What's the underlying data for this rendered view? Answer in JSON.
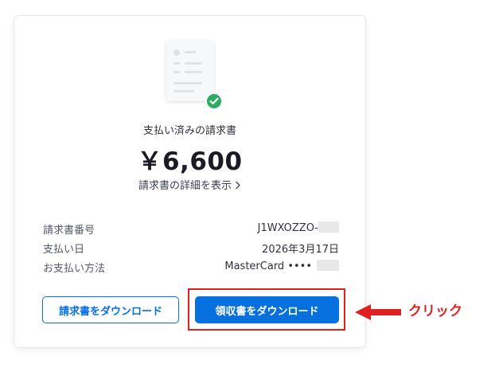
{
  "receipt": {
    "status_title": "支払い済みの請求書",
    "amount": "￥6,600",
    "details_link": "請求書の詳細を表示",
    "rows": [
      {
        "label": "請求書番号",
        "value": "J1WXOZZO-"
      },
      {
        "label": "支払い日",
        "value": "2026年3月17日"
      },
      {
        "label": "お支払い方法",
        "value": "MasterCard ••••"
      }
    ],
    "download_invoice_label": "請求書をダウンロード",
    "download_receipt_label": "領収書をダウンロード"
  },
  "annotation": {
    "click_label": "クリック",
    "color": "#e02020"
  },
  "colors": {
    "primary": "#0570de",
    "success": "#2cab65"
  },
  "icons": {
    "document": "invoice-document-icon",
    "check": "check-circle-icon",
    "chevron": "chevron-right-icon",
    "arrow": "arrow-left-icon"
  }
}
